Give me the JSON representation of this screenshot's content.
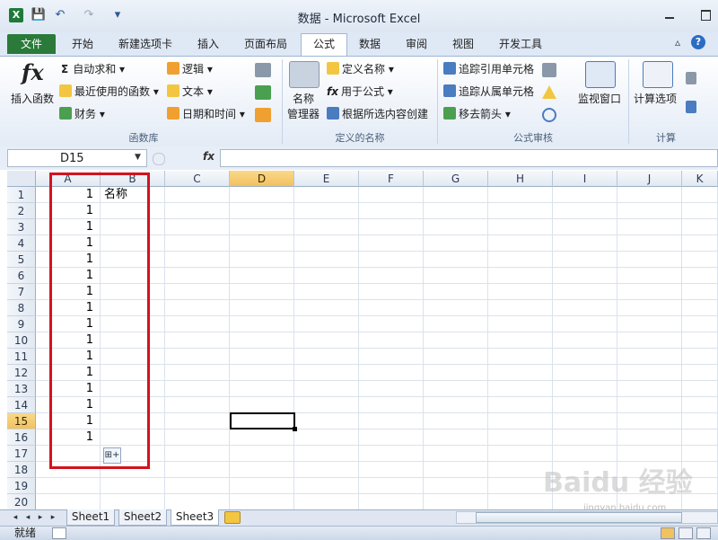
{
  "window": {
    "title": "数据 - Microsoft Excel",
    "qat_save": "💾",
    "qat_undo": "↶",
    "qat_redo": "↷",
    "qat_more": "▾"
  },
  "ribbon_tabs": [
    "文件",
    "开始",
    "新建选项卡",
    "插入",
    "页面布局",
    "公式",
    "数据",
    "审阅",
    "视图",
    "开发工具"
  ],
  "ribbon_right": {
    "collapse": "▵",
    "help": "?",
    "min": "─",
    "restore": "❐",
    "close": "✕"
  },
  "groups": {
    "function_library": {
      "label": "函数库",
      "insert_function": "插入函数",
      "autosum": "自动求和",
      "recent": "最近使用的函数",
      "financial": "财务",
      "logical": "逻辑",
      "text": "文本",
      "datetime": "日期和时间"
    },
    "defined_names": {
      "label": "定义的名称",
      "name_manager_1": "名称",
      "name_manager_2": "管理器",
      "define_name": "定义名称",
      "use_in_formula": "用于公式",
      "create_from_selection": "根据所选内容创建"
    },
    "formula_auditing": {
      "label": "公式审核",
      "trace_precedents": "追踪引用单元格",
      "trace_dependents": "追踪从属单元格",
      "remove_arrows": "移去箭头",
      "watch_window": "监视窗口"
    },
    "calculation": {
      "label": "计算",
      "calc_options": "计算选项"
    }
  },
  "formula_bar": {
    "name_box": "D15",
    "fx": "fx",
    "content": ""
  },
  "columns": [
    "A",
    "B",
    "C",
    "D",
    "E",
    "F",
    "G",
    "H",
    "I",
    "J",
    "K"
  ],
  "selected_column": "D",
  "rows": [
    "1",
    "2",
    "3",
    "4",
    "5",
    "6",
    "7",
    "8",
    "9",
    "10",
    "11",
    "12",
    "13",
    "14",
    "15",
    "16",
    "17",
    "18",
    "19",
    "20"
  ],
  "selected_row": "15",
  "cells_A": [
    "1",
    "1",
    "1",
    "1",
    "1",
    "1",
    "1",
    "1",
    "1",
    "1",
    "1",
    "1",
    "1",
    "1",
    "1",
    "1"
  ],
  "cell_B1": "名称",
  "active_cell": "D15",
  "sheets": [
    "Sheet1",
    "Sheet2",
    "Sheet3"
  ],
  "active_sheet": "Sheet3",
  "status": "就绪",
  "watermark": "Baidu 经验",
  "watermark_sub": "jingyan.baidu.com",
  "colors": {
    "highlight_box": "#d4121e",
    "file_tab": "#2a7a3a",
    "selected_header": "#f2c160"
  }
}
